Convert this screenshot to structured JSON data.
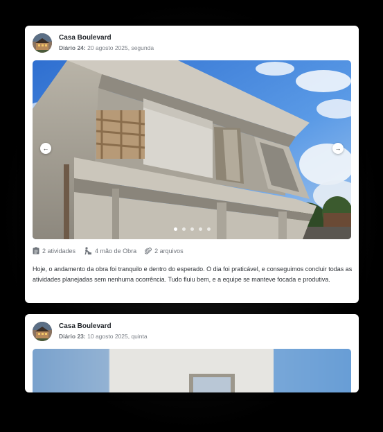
{
  "posts": [
    {
      "project": "Casa Boulevard",
      "diary_label": "Diário 24:",
      "date": "20 agosto 2025, segunda",
      "stats": {
        "activities": "2 atividades",
        "labor": "4 mão de Obra",
        "files": "2 arquivos"
      },
      "text": "Hoje, o andamento da obra foi tranquilo e dentro do esperado. O dia foi praticável, e conseguimos concluir todas as atividades planejadas sem nenhuma ocorrência. Tudo fluiu bem, e a equipe se manteve focada e produtiva.",
      "carousel": {
        "total": 5,
        "active": 1
      }
    },
    {
      "project": "Casa Boulevard",
      "diary_label": "Diário 23:",
      "date": "10 agosto 2025, quinta"
    }
  ],
  "icons": {
    "prev": "arrow-left-icon",
    "next": "arrow-right-icon",
    "activities": "clipboard-icon",
    "labor": "worker-icon",
    "files": "paperclip-icon"
  },
  "colors": {
    "page_bg": "#000000",
    "card_bg": "#ffffff",
    "text": "#2d3136",
    "muted": "#7a7f86"
  }
}
